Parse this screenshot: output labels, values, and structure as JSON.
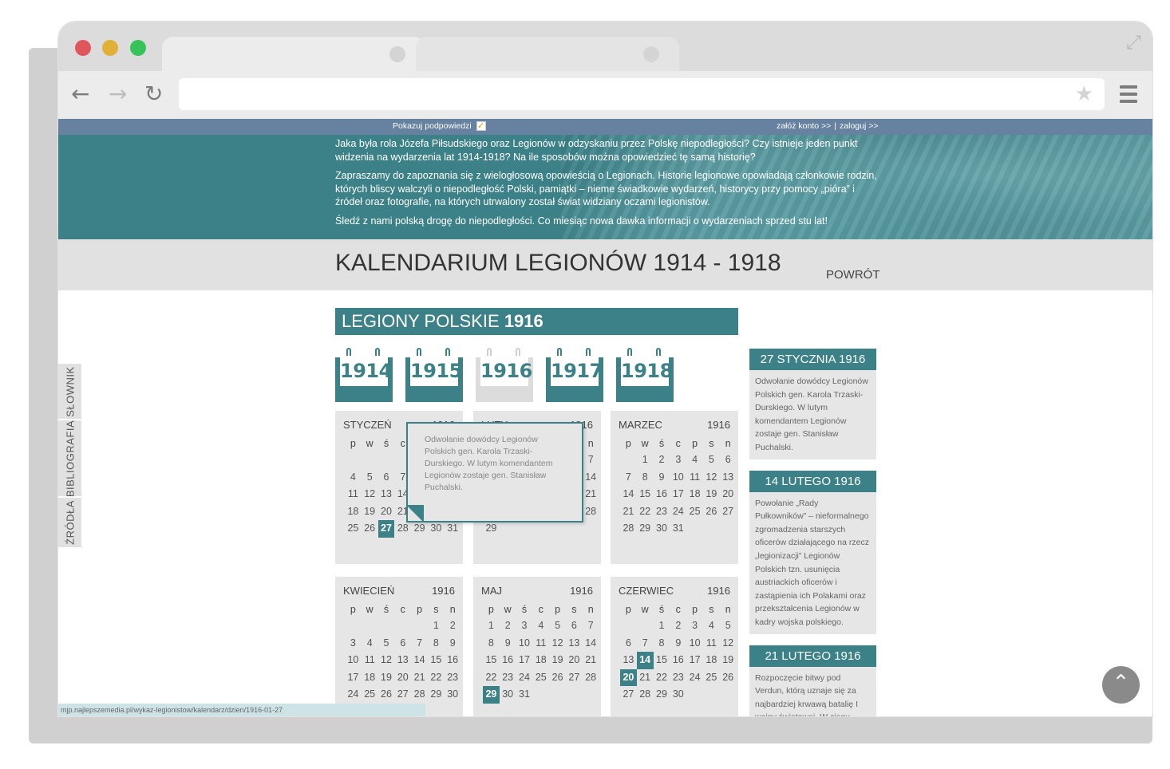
{
  "browser": {
    "colors": {
      "close": "#e0575b",
      "minimize": "#e1b137",
      "maximize": "#35c35a",
      "accent": "#3c8188"
    },
    "icons": [
      "back-arrow-icon",
      "forward-arrow-icon",
      "reload-icon",
      "star-icon",
      "menu-icon",
      "expand-icon"
    ]
  },
  "topbar": {
    "hints_label": "Pokazuj podpowiedzi",
    "hints_checked": "✓",
    "register": "załóż konto >>",
    "separator": "|",
    "login": "zaloguj >>"
  },
  "banner": {
    "p1": "Jaka była rola Józefa Piłsudskiego oraz Legionów w odzyskaniu przez Polskę niepodległości? Czy istnieje jeden punkt widzenia na wydarzenia lat 1914-1918? Na ile sposobów można opowiedzieć tę samą historię?",
    "p2": "Zapraszamy do zapoznania się z wielogłosową opowieścią o Legionach. Historie legionowe opowiadają członkowie rodzin, których bliscy walczyli o niepodległość Polski, pamiątki – nieme świadkowie wydarzeń, historycy przy pomocy „pióra” i źródeł oraz fotografie, na których utrwalony został świat widziany oczami legionistów.",
    "p3": "Śledź z nami polską drogę do niepodległości. Co miesiąc nowa dawka informacji o wydarzeniach sprzed stu lat!"
  },
  "title": {
    "text": "KALENDARIUM LEGIONÓW 1914 - 1918",
    "back": "POWRÓT"
  },
  "side_tabs": [
    "SŁOWNIK",
    "BIBLIOGRAFIA",
    "ŹRÓDŁA"
  ],
  "year_header": {
    "prefix": "LEGIONY POLSKIE",
    "year": "1916"
  },
  "years": [
    {
      "label": "1914",
      "active": true
    },
    {
      "label": "1915",
      "active": true
    },
    {
      "label": "1916",
      "active": false
    },
    {
      "label": "1917",
      "active": true
    },
    {
      "label": "1918",
      "active": true
    }
  ],
  "weekdays": [
    "p",
    "w",
    "ś",
    "c",
    "p",
    "s",
    "n"
  ],
  "months": [
    {
      "name": "STYCZEŃ",
      "year": "1916",
      "offset": 4,
      "days": 31,
      "highlight": [
        27
      ]
    },
    {
      "name": "LUTY",
      "year": "1916",
      "offset": 0,
      "days": 29,
      "highlight": []
    },
    {
      "name": "MARZEC",
      "year": "1916",
      "offset": 1,
      "days": 31,
      "highlight": []
    },
    {
      "name": "KWIECIEŃ",
      "year": "1916",
      "offset": 5,
      "days": 30,
      "highlight": []
    },
    {
      "name": "MAJ",
      "year": "1916",
      "offset": 0,
      "days": 31,
      "highlight": [
        29
      ]
    },
    {
      "name": "CZERWIEC",
      "year": "1916",
      "offset": 2,
      "days": 30,
      "highlight": [
        14,
        20
      ]
    }
  ],
  "tooltip": {
    "text": "Odwołanie dowódcy Legionów Polskich gen. Karola Trzaski-Durskiego. W lutym komendantem Legionów zostaje gen. Stanisław Puchalski."
  },
  "events": [
    {
      "date": "27 STYCZNIA 1916",
      "text": "Odwołanie dowódcy Legionów Polskich gen. Karola Trzaski-Durskiego. W lutym komendantem Legionów zostaje gen. Stanisław Puchalski."
    },
    {
      "date": "14 LUTEGO 1916",
      "text": "Powołanie „Rady Pułkowników” – nieformalnego zgromadzenia starszych oficerów działającego na rzecz „legionizacji” Legionów Polskich tzn. usunięcia austriackich oficerów i zastąpienia ich Polakami oraz przekształcenia Legionów w kadry wojska polskiego."
    },
    {
      "date": "21 LUTEGO 1916",
      "text": "Rozpoczęcie bitwy pod Verdun, którą uznaje się za najbardziej krwawą batalię I wojny światowej. W ciągu dziesięciu miesięcy zginęło..."
    }
  ],
  "status_url": "mjp.najlepszemedia.pl/wykaz-legionistow/kalendarz/dzien/1916-01-27"
}
